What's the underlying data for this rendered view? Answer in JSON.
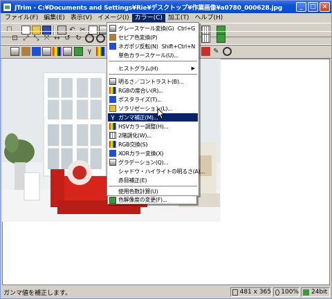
{
  "window": {
    "title": "JTrim - C:¥Documents and Settings¥Rie¥デスクトップ¥作業画像¥a0780_000628.jpg",
    "controls": {
      "minimize": "_",
      "maximize": "□",
      "close": "×"
    }
  },
  "menubar": {
    "items": [
      {
        "label": "ファイル(F)"
      },
      {
        "label": "編集(E)"
      },
      {
        "label": "表示(V)"
      },
      {
        "label": "イメージ(I)"
      },
      {
        "label": "カラー(C)"
      },
      {
        "label": "加工(T)"
      },
      {
        "label": "ヘルプ(H)"
      }
    ],
    "active_index": 4
  },
  "color_menu": {
    "items": [
      {
        "label": "グレースケール変換(G)",
        "shortcut": "Ctrl+G",
        "icon": "grayscale-icon"
      },
      {
        "label": "セピア色変換(P)",
        "icon": "sepia-icon"
      },
      {
        "label": "ネガポジ反転(N)",
        "shortcut": "Shift+Ctrl+N",
        "icon": "negative-icon"
      },
      {
        "label": "単色カラースケール(U)...",
        "icon": ""
      },
      {
        "separator": true
      },
      {
        "label": "ヒストグラム(H)",
        "submenu": true,
        "icon": ""
      },
      {
        "separator": true
      },
      {
        "label": "明るさ／コントラスト(B)...",
        "icon": "brightness-icon"
      },
      {
        "label": "RGBの度合い(R)...",
        "icon": "rgb-icon"
      },
      {
        "label": "ポスタライズ(T)...",
        "icon": "posterize-icon"
      },
      {
        "label": "ソラリゼーション(L)...",
        "icon": "solarize-icon"
      },
      {
        "label": "ガンマ補正(M)...",
        "icon": "gamma-icon",
        "highlighted": true
      },
      {
        "label": "HSVカラー調整(H)...",
        "icon": "hsv-icon"
      },
      {
        "label": "2階調化(W)...",
        "icon": "twotone-icon"
      },
      {
        "label": "RGB交換(S)",
        "icon": "rgb-swap-icon"
      },
      {
        "label": "XORカラー変換(X)",
        "icon": "xor-icon"
      },
      {
        "label": "グラデーション(Q)...",
        "icon": "gradient-icon"
      },
      {
        "label": "シャドウ・ハイライトの明るさ(A)...",
        "icon": ""
      },
      {
        "label": "赤目補正(E)",
        "icon": ""
      },
      {
        "separator": true
      },
      {
        "label": "使用色数計算(U)",
        "icon": ""
      },
      {
        "label": "色解像度の変更(F)...",
        "icon": "color-depth-icon"
      }
    ]
  },
  "statusbar": {
    "message": "ガンマ値を補正します。",
    "image_size": "481 x 365",
    "zoom": "100%",
    "color_depth": "24bit"
  }
}
